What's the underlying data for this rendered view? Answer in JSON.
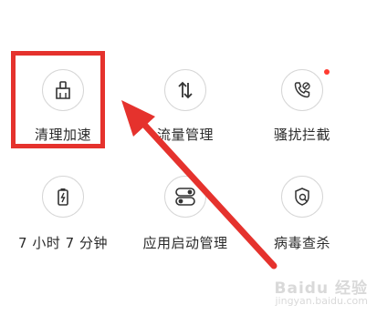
{
  "tiles": [
    {
      "label": "清理加速",
      "icon": "broom-icon"
    },
    {
      "label": "流量管理",
      "icon": "data-transfer-icon"
    },
    {
      "label": "骚扰拦截",
      "icon": "phone-block-icon",
      "has_badge": true
    },
    {
      "label": "7 小时 7 分钟",
      "icon": "battery-icon"
    },
    {
      "label": "应用启动管理",
      "icon": "toggle-apps-icon"
    },
    {
      "label": "病毒查杀",
      "icon": "shield-search-icon"
    }
  ],
  "colors": {
    "highlight": "#e5322d",
    "badge": "#ff3b30",
    "arrow": "#e5322d"
  },
  "watermark": {
    "brand": "Baidu 经验",
    "url": "jingyan.baidu.com"
  }
}
